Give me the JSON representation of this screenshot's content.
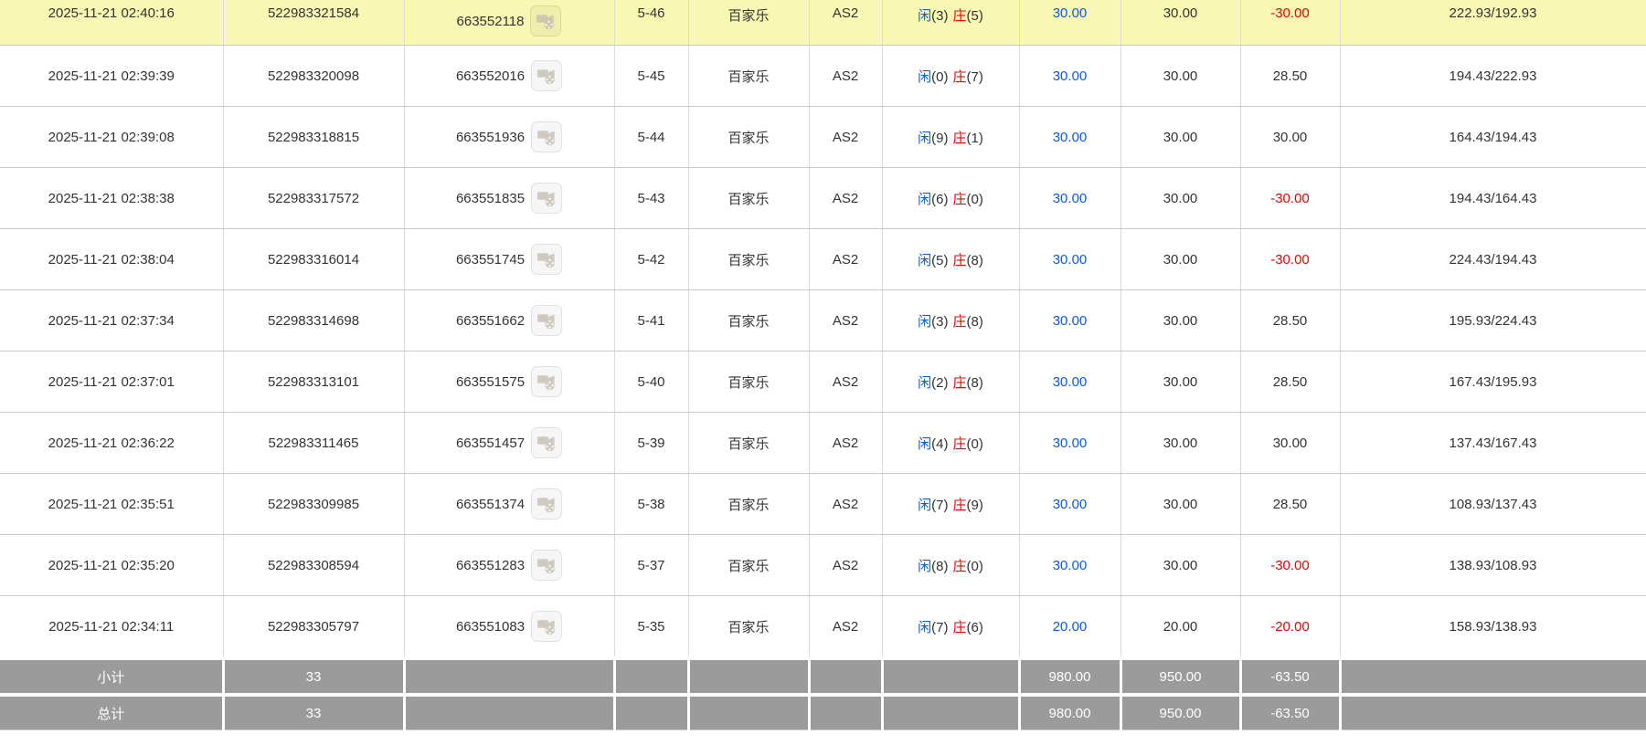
{
  "colors": {
    "highlight_row": "#f8f7b3",
    "blue": "#0b58ef",
    "red": "#ec0000",
    "summary_bg": "#9b9b9b",
    "grid_border": "#c9c9c9"
  },
  "icons": {
    "row_action": "video-replay-icon"
  },
  "table": {
    "result_labels": {
      "player": "闲",
      "banker": "庄"
    },
    "rows": [
      {
        "time": "2025-11-21 02:40:16",
        "bet_id": "522983321584",
        "game_id": "663552118",
        "round": "5-46",
        "game": "百家乐",
        "table": "AS2",
        "player_score": "3",
        "banker_score": "5",
        "bet": "30.00",
        "valid": "30.00",
        "winloss": "-30.00",
        "balance": "222.93/192.93",
        "highlight": true
      },
      {
        "time": "2025-11-21 02:39:39",
        "bet_id": "522983320098",
        "game_id": "663552016",
        "round": "5-45",
        "game": "百家乐",
        "table": "AS2",
        "player_score": "0",
        "banker_score": "7",
        "bet": "30.00",
        "valid": "30.00",
        "winloss": "28.50",
        "balance": "194.43/222.93",
        "highlight": false
      },
      {
        "time": "2025-11-21 02:39:08",
        "bet_id": "522983318815",
        "game_id": "663551936",
        "round": "5-44",
        "game": "百家乐",
        "table": "AS2",
        "player_score": "9",
        "banker_score": "1",
        "bet": "30.00",
        "valid": "30.00",
        "winloss": "30.00",
        "balance": "164.43/194.43",
        "highlight": false
      },
      {
        "time": "2025-11-21 02:38:38",
        "bet_id": "522983317572",
        "game_id": "663551835",
        "round": "5-43",
        "game": "百家乐",
        "table": "AS2",
        "player_score": "6",
        "banker_score": "0",
        "bet": "30.00",
        "valid": "30.00",
        "winloss": "-30.00",
        "balance": "194.43/164.43",
        "highlight": false
      },
      {
        "time": "2025-11-21 02:38:04",
        "bet_id": "522983316014",
        "game_id": "663551745",
        "round": "5-42",
        "game": "百家乐",
        "table": "AS2",
        "player_score": "5",
        "banker_score": "8",
        "bet": "30.00",
        "valid": "30.00",
        "winloss": "-30.00",
        "balance": "224.43/194.43",
        "highlight": false
      },
      {
        "time": "2025-11-21 02:37:34",
        "bet_id": "522983314698",
        "game_id": "663551662",
        "round": "5-41",
        "game": "百家乐",
        "table": "AS2",
        "player_score": "3",
        "banker_score": "8",
        "bet": "30.00",
        "valid": "30.00",
        "winloss": "28.50",
        "balance": "195.93/224.43",
        "highlight": false
      },
      {
        "time": "2025-11-21 02:37:01",
        "bet_id": "522983313101",
        "game_id": "663551575",
        "round": "5-40",
        "game": "百家乐",
        "table": "AS2",
        "player_score": "2",
        "banker_score": "8",
        "bet": "30.00",
        "valid": "30.00",
        "winloss": "28.50",
        "balance": "167.43/195.93",
        "highlight": false
      },
      {
        "time": "2025-11-21 02:36:22",
        "bet_id": "522983311465",
        "game_id": "663551457",
        "round": "5-39",
        "game": "百家乐",
        "table": "AS2",
        "player_score": "4",
        "banker_score": "0",
        "bet": "30.00",
        "valid": "30.00",
        "winloss": "30.00",
        "balance": "137.43/167.43",
        "highlight": false
      },
      {
        "time": "2025-11-21 02:35:51",
        "bet_id": "522983309985",
        "game_id": "663551374",
        "round": "5-38",
        "game": "百家乐",
        "table": "AS2",
        "player_score": "7",
        "banker_score": "9",
        "bet": "30.00",
        "valid": "30.00",
        "winloss": "28.50",
        "balance": "108.93/137.43",
        "highlight": false
      },
      {
        "time": "2025-11-21 02:35:20",
        "bet_id": "522983308594",
        "game_id": "663551283",
        "round": "5-37",
        "game": "百家乐",
        "table": "AS2",
        "player_score": "8",
        "banker_score": "0",
        "bet": "30.00",
        "valid": "30.00",
        "winloss": "-30.00",
        "balance": "138.93/108.93",
        "highlight": false
      },
      {
        "time": "2025-11-21 02:34:11",
        "bet_id": "522983305797",
        "game_id": "663551083",
        "round": "5-35",
        "game": "百家乐",
        "table": "AS2",
        "player_score": "7",
        "banker_score": "6",
        "bet": "20.00",
        "valid": "20.00",
        "winloss": "-20.00",
        "balance": "158.93/138.93",
        "highlight": false
      }
    ],
    "summary": [
      {
        "label": "小计",
        "count": "33",
        "bet": "980.00",
        "valid": "950.00",
        "winloss": "-63.50"
      },
      {
        "label": "总计",
        "count": "33",
        "bet": "980.00",
        "valid": "950.00",
        "winloss": "-63.50"
      }
    ]
  }
}
